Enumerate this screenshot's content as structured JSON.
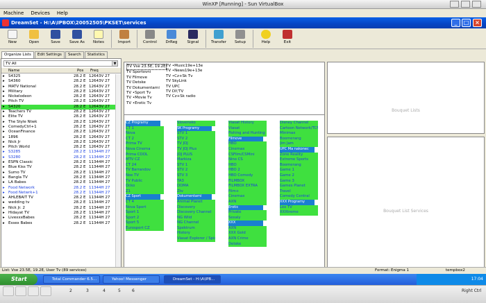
{
  "vbox": {
    "title": "WinXP [Running] - Sun VirtualBox",
    "menu": [
      "Machine",
      "Devices",
      "Help"
    ]
  },
  "app": {
    "title": "DreamSet - H:\\A\\IPBOX\\20052505\\PKSET\\services",
    "toolbar": [
      "New",
      "Open",
      "Save",
      "Save As",
      "Notes",
      "Import",
      "Control",
      "DrReg",
      "Signal",
      "Transfer",
      "Setup",
      "Help",
      "Exit"
    ],
    "tabs": [
      "Organize Lists",
      "Edit Settings",
      "Search",
      "Statistics"
    ],
    "filter": "TV All",
    "columns": [
      "Name",
      "Pos",
      "Freq"
    ],
    "rows": [
      [
        "S4325",
        "28.2 E",
        "12643V 27"
      ],
      [
        "S4360",
        "28.2 E",
        "12643V 27"
      ],
      [
        "MATV National",
        "28.2 E",
        "12643V 27"
      ],
      [
        "Military",
        "28.2 E",
        "12643V 27"
      ],
      [
        "Nickelodeon",
        "28.2 E",
        "12643V 27"
      ],
      [
        "Pitch TV",
        "28.2 E",
        "12643V 27"
      ],
      [
        "S4320",
        "28.2 E",
        "12643V 27"
      ],
      [
        "Teachers TV",
        "28.2 E",
        "12643V 27"
      ],
      [
        "Elite TV",
        "28.2 E",
        "12643V 27"
      ],
      [
        "The Style Ntwk",
        "28.2 E",
        "12643V 27"
      ],
      [
        "ComedyCtrl+1",
        "28.2 E",
        "12643V 27"
      ],
      [
        "OceanFinance",
        "28.2 E",
        "12643V 27"
      ],
      [
        "1896",
        "28.2 E",
        "12643V 27"
      ],
      [
        "Nick Jr",
        "28.2 E",
        "12643V 27"
      ],
      [
        "Pitch World",
        "28.2 E",
        "12643V 27"
      ],
      [
        "S3285",
        "28.2 E",
        "11344H 27"
      ],
      [
        "S3280",
        "28.2 E",
        "11344H 27"
      ],
      [
        "ESPN Classic",
        "28.2 E",
        "11344H 27"
      ],
      [
        "Blue Kiss TV",
        "28.2 E",
        "11344H 27"
      ],
      [
        "Sumo TV",
        "28.2 E",
        "11344H 27"
      ],
      [
        "Bangla TV",
        "28.2 E",
        "11344H 27"
      ],
      [
        "LA Babes",
        "28.2 E",
        "11344H 27"
      ],
      [
        "Food Network",
        "28.2 E",
        "11344H 27"
      ],
      [
        "Food Netwrk+1",
        "28.2 E",
        "11344H 27"
      ],
      [
        "AHLEBAIT TV",
        "28.2 E",
        "11344H 27"
      ],
      [
        "wedding tv",
        "28.2 E",
        "11344H 27"
      ],
      [
        "Nick Jr. 2",
        "28.2 E",
        "11344H 27"
      ],
      [
        "Hidayat TV",
        "28.2 E",
        "11344H 27"
      ],
      [
        "LivexxxBabes",
        "28.2 E",
        "11344H 27"
      ],
      [
        "Essex Babes",
        "28.2 E",
        "11344H 27"
      ]
    ],
    "highlight_row": 6,
    "blue_rows": [
      15,
      16,
      22,
      23
    ],
    "bouquets_col1": [
      "Vse 23.5E, 19.2E",
      "Sportovni",
      "Filmove",
      "Detske",
      "Dokumentarni",
      "•Sport Tv",
      "•Movie Tv",
      "•Erotic Tv"
    ],
    "bouquets_col2": [
      "•Music19e+13e",
      "•News19e+13e",
      "•Cz+Sk Tv",
      "SkyLink",
      "UPC",
      "DI\\'TV",
      "Cz+Sk radio"
    ],
    "bouquet_lists_label": "Bouquet Lists",
    "bouquet_services_label": "Bouquet List Services",
    "list1": [
      [
        "CZ Programy",
        "s"
      ],
      [
        "CT 1",
        "g"
      ],
      [
        "Nova",
        "g"
      ],
      [
        "CT 2",
        "g"
      ],
      [
        "Prima TV",
        "g"
      ],
      [
        "Nova Cinema",
        "g"
      ],
      [
        "Prima COOL",
        "g"
      ],
      [
        "MTV CZ",
        "g"
      ],
      [
        "CT 24",
        "g"
      ],
      [
        "TV Barrandov",
        "g"
      ],
      [
        "Noe TV",
        "g"
      ],
      [
        "TV Public",
        "g"
      ],
      [
        "Ocko",
        "g"
      ],
      [
        "Z1",
        "g"
      ],
      [
        "CZ Sport",
        "s"
      ],
      [
        "CT 4",
        "g"
      ],
      [
        "Nova Sport",
        "g"
      ],
      [
        "Sport 1",
        "g"
      ],
      [
        "Sport 2",
        "g"
      ],
      [
        "Sport 5",
        "g"
      ],
      [
        "Eurosport CZ",
        "g"
      ]
    ],
    "list2": [
      [
        "Slovensko",
        "g"
      ],
      [
        "SK Programy",
        "s"
      ],
      [
        "STV 1",
        "g"
      ],
      [
        "STV 2",
        "g"
      ],
      [
        "TV JOJ",
        "g"
      ],
      [
        "TV JOJ Plus",
        "g"
      ],
      [
        "JOJ PLUS",
        "g"
      ],
      [
        "Markiza",
        "g"
      ],
      [
        "STV 1",
        "g"
      ],
      [
        "STV 2",
        "g"
      ],
      [
        "STV 3",
        "g"
      ],
      [
        "TA3",
        "g"
      ],
      [
        "DOMA",
        "g"
      ],
      [
        "Ztv",
        "g"
      ],
      [
        "Dokumentarni",
        "s"
      ],
      [
        "Animal Planet",
        "g"
      ],
      [
        "Discovery",
        "g"
      ],
      [
        "Discovery Channel",
        "g"
      ],
      [
        "NG Wild",
        "g"
      ],
      [
        "NG Channel",
        "g"
      ],
      [
        "Spektrum",
        "g"
      ],
      [
        "History",
        "g"
      ],
      [
        "Viasat Explorer / Spice",
        "g"
      ]
    ],
    "list3": [
      [
        "Viasat History",
        "g"
      ],
      [
        "Viasat",
        "g"
      ],
      [
        "Fishing and Hunting",
        "g"
      ],
      [
        "Filmove",
        "s"
      ],
      [
        "HBO",
        "g"
      ],
      [
        "Cinemax",
        "g"
      ],
      [
        "CSFilm/CSMini",
        "g"
      ],
      [
        "Nino CS",
        "g"
      ],
      [
        "HBO",
        "g"
      ],
      [
        "HBO 2",
        "g"
      ],
      [
        "HBO Comedy",
        "g"
      ],
      [
        "FILMBOX",
        "g"
      ],
      [
        "FILMBOX EXTRA",
        "g"
      ],
      [
        "Film+",
        "g"
      ],
      [
        "Cinemax",
        "g"
      ],
      [
        "AXN",
        "g"
      ],
      [
        "Erotic",
        "s"
      ],
      [
        "Private",
        "g"
      ],
      [
        "Sexaly",
        "g"
      ],
      [
        "XXX",
        "s"
      ],
      [
        "AXN",
        "g"
      ],
      [
        "XXX Gold",
        "g"
      ],
      [
        "AXN Crime",
        "g"
      ],
      [
        "Detske",
        "g"
      ]
    ],
    "list4": [
      [
        "Disney Channel",
        "g"
      ],
      [
        "Cartoon Network/TCM",
        "g"
      ],
      [
        "Minimax",
        "g"
      ],
      [
        "Boomerang",
        "g"
      ],
      [
        "Jim Jam",
        "g"
      ],
      [
        "UPC Ma nakonec",
        "s"
      ],
      [
        "Zone Reality",
        "g"
      ],
      [
        "Extreme Sports",
        "g"
      ],
      [
        "Boomerang",
        "g"
      ],
      [
        "Game 1",
        "g"
      ],
      [
        "Game 2",
        "g"
      ],
      [
        "Game 3",
        "g"
      ],
      [
        "Games Planet",
        "g"
      ],
      [
        "Travel",
        "g"
      ],
      [
        "Comedy Central",
        "g"
      ],
      [
        "XXX Programy",
        "s"
      ],
      [
        "Leo TV",
        "g"
      ],
      [
        "XXXtreme",
        "g"
      ]
    ],
    "status": {
      "left": "List: Vse 23.5E, 19.2E, User Tv (89 services)",
      "format": "Format: Enigma 1",
      "box": "tempbox2"
    }
  },
  "taskbar": {
    "start": "Start",
    "tasks": [
      "Total Commander 6.5...",
      "Yahoo! Messenger",
      "DreamSet - H:\\A\\IPB..."
    ],
    "clock": "17:04"
  },
  "host": {
    "right": "Right Ctrl",
    "pages": [
      "2",
      "3",
      "4",
      "5",
      "6"
    ]
  }
}
